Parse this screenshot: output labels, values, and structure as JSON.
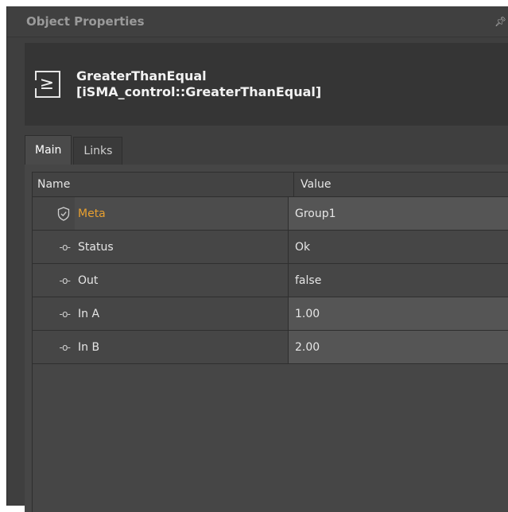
{
  "panel": {
    "title": "Object Properties",
    "pin_icon": "pin-icon"
  },
  "header": {
    "icon": "greater-than-equal-icon",
    "icon_symbol": "≥",
    "name": "GreaterThanEqual",
    "type": "[iSMA_control::GreaterThanEqual]"
  },
  "tabs": [
    {
      "label": "Main",
      "active": true
    },
    {
      "label": "Links",
      "active": false
    }
  ],
  "table": {
    "col_name": "Name",
    "col_value": "Value",
    "rows": [
      {
        "icon": "shield-icon",
        "name": "Meta",
        "value": "Group1",
        "highlight_color": "#e8a030",
        "editable": true
      },
      {
        "icon": "slot-icon",
        "icon_glyph": "-o-",
        "name": "Status",
        "value": "Ok",
        "editable": false
      },
      {
        "icon": "slot-icon",
        "icon_glyph": "-o-",
        "name": "Out",
        "value": "false",
        "editable": false
      },
      {
        "icon": "slot-icon",
        "icon_glyph": "-o-",
        "name": "In A",
        "value": "1.00",
        "editable": true
      },
      {
        "icon": "slot-icon",
        "icon_glyph": "-o-",
        "name": "In B",
        "value": "2.00",
        "editable": true
      }
    ]
  }
}
